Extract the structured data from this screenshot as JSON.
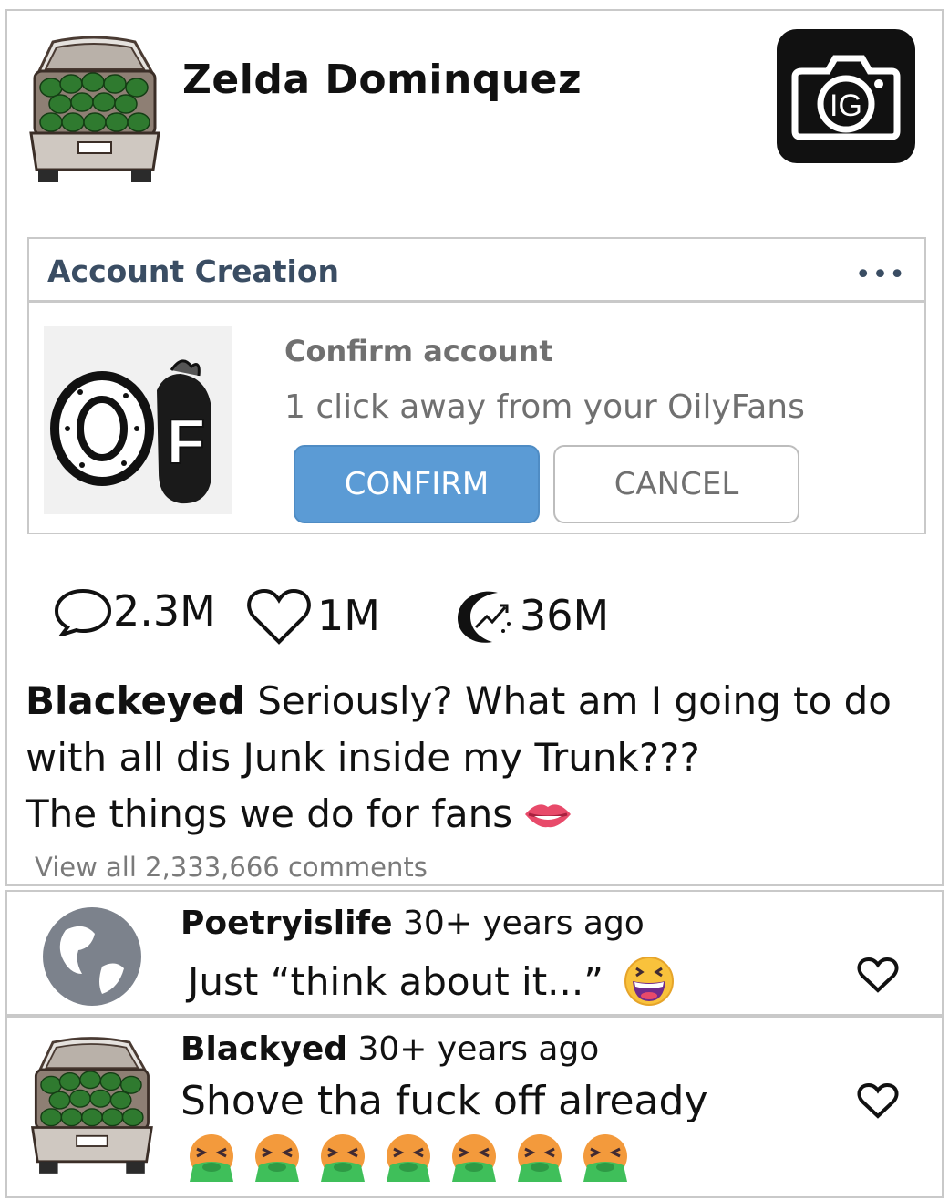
{
  "post": {
    "username": "Zelda Dominquez",
    "ig_button_label": "IG",
    "dialog": {
      "title": "Account Creation",
      "more_label": "•••",
      "logo_text": "OF",
      "confirm_title": "Confirm account",
      "subtitle": "1 click away from your OilyFans",
      "confirm_label": "CONFIRM",
      "cancel_label": "CANCEL"
    },
    "stats": {
      "comments": "2.3M",
      "likes": "1M",
      "reposts": "36M"
    },
    "caption": {
      "author": "Blackeyed",
      "line1": "Seriously? What am I going to do",
      "line2": "with all dis Junk inside my Trunk???",
      "line3": "The things we do for fans",
      "emoji": "lips"
    },
    "view_all": "View all 2,333,666 comments"
  },
  "comments": [
    {
      "author": "Poetryislife",
      "time": "30+ years ago",
      "text": "Just “think about it...”",
      "emoji": "grinning-squinting-face"
    },
    {
      "author": "Blackyed",
      "time": "30+ years ago",
      "text": "Shove tha fuck off already",
      "emoji": "vomiting-face",
      "emoji_count": 7
    }
  ],
  "colors": {
    "confirm_blue": "#5b9bd5",
    "dialog_title": "#3a4d63",
    "muted_text": "#707070"
  }
}
